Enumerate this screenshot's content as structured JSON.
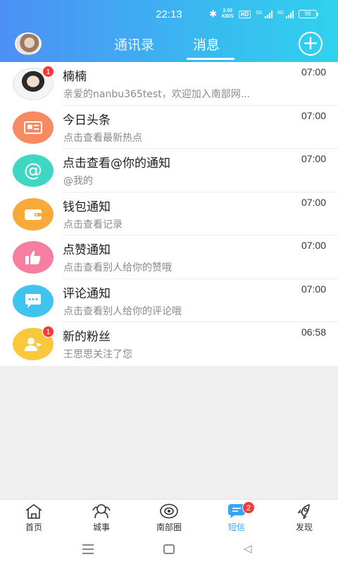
{
  "status_bar": {
    "time": "22:13",
    "net_speed_value": "2.00",
    "net_speed_unit": "KB/S",
    "hd_label": "HD",
    "signal1_label": "5G",
    "signal2_label": "4G",
    "battery": "99"
  },
  "header": {
    "tabs": [
      "通讯录",
      "消息"
    ],
    "active_tab": "消息",
    "plus_symbol": "+"
  },
  "messages": [
    {
      "title": "楠楠",
      "subtitle": "亲爱的nanbu365test，欢迎加入南部网...",
      "time": "07:00",
      "badge": "1",
      "avatar": "user-photo",
      "color": "#f0d6c8"
    },
    {
      "title": "今日头条",
      "subtitle": "点击查看最新热点",
      "time": "07:00",
      "badge": "",
      "avatar": "newspaper-icon",
      "color": "#f78a60"
    },
    {
      "title": "点击查看@你的通知",
      "subtitle": "@我的",
      "time": "07:00",
      "badge": "",
      "avatar": "at-sign-icon",
      "color": "#3fd6c4"
    },
    {
      "title": "钱包通知",
      "subtitle": "点击查看记录",
      "time": "07:00",
      "badge": "",
      "avatar": "wallet-icon",
      "color": "#f7a93a"
    },
    {
      "title": "点赞通知",
      "subtitle": "点击查看别人给你的赞哦",
      "time": "07:00",
      "badge": "",
      "avatar": "thumbs-up-icon",
      "color": "#f57ea1"
    },
    {
      "title": "评论通知",
      "subtitle": "点击查看别人给你的评论哦",
      "time": "07:00",
      "badge": "",
      "avatar": "chat-bubble-icon",
      "color": "#3ec4ee"
    },
    {
      "title": "新的粉丝",
      "subtitle": "王思思关注了您",
      "time": "06:58",
      "badge": "1",
      "avatar": "new-follower-icon",
      "color": "#f9c83c"
    }
  ],
  "bottom_nav": [
    {
      "label": "首页",
      "icon": "home-icon",
      "active": false,
      "badge": ""
    },
    {
      "label": "城事",
      "icon": "city-icon",
      "active": false,
      "badge": ""
    },
    {
      "label": "南部圈",
      "icon": "circle-eye-icon",
      "active": false,
      "badge": ""
    },
    {
      "label": "短信",
      "icon": "message-icon",
      "active": true,
      "badge": "2"
    },
    {
      "label": "发现",
      "icon": "rocket-icon",
      "active": false,
      "badge": ""
    }
  ],
  "accent_color": "#38a4f3"
}
